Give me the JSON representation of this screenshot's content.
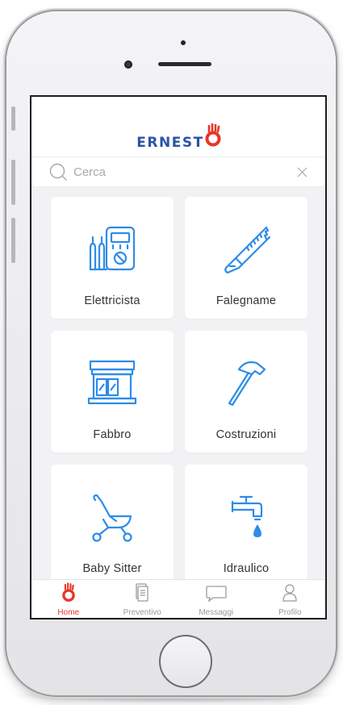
{
  "app": {
    "logo_text": "ERNEST",
    "brand_color": "#2a54a8",
    "accent_color": "#e8352a",
    "icon_color": "#2d8ce8"
  },
  "search": {
    "placeholder": "Cerca",
    "value": ""
  },
  "categories": [
    {
      "label": "Elettricista",
      "icon": "multimeter-icon"
    },
    {
      "label": "Falegname",
      "icon": "saw-icon"
    },
    {
      "label": "Fabbro",
      "icon": "shutter-window-icon"
    },
    {
      "label": "Costruzioni",
      "icon": "hammer-icon"
    },
    {
      "label": "Baby Sitter",
      "icon": "stroller-icon"
    },
    {
      "label": "Idraulico",
      "icon": "faucet-icon"
    }
  ],
  "tabs": [
    {
      "label": "Home",
      "icon": "ernesto-hand-icon",
      "active": true
    },
    {
      "label": "Preventivo",
      "icon": "document-icon",
      "active": false
    },
    {
      "label": "Messaggi",
      "icon": "chat-bubble-icon",
      "active": false
    },
    {
      "label": "Profilo",
      "icon": "user-icon",
      "active": false
    }
  ]
}
